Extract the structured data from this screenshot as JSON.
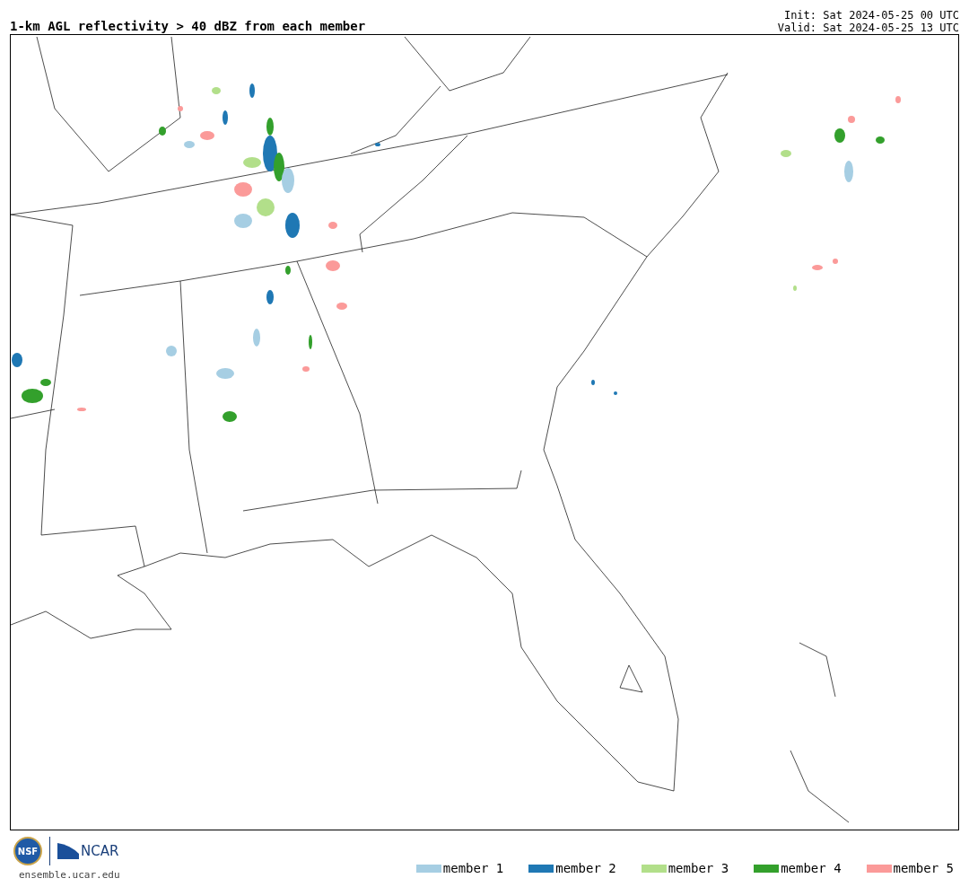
{
  "title": "1-km AGL reflectivity > 40 dBZ from each member",
  "init": "Init: Sat 2024-05-25 00 UTC",
  "valid": "Valid: Sat 2024-05-25 13 UTC",
  "logos": {
    "nsf": "NSF",
    "ncar": "NCAR"
  },
  "site": "ensemble.ucar.edu",
  "legend": [
    {
      "label": "member 1",
      "color": "#a6cee3"
    },
    {
      "label": "member 2",
      "color": "#1f78b4"
    },
    {
      "label": "member 3",
      "color": "#b2df8a"
    },
    {
      "label": "member 4",
      "color": "#33a02c"
    },
    {
      "label": "member 5",
      "color": "#fb9a99"
    }
  ]
}
